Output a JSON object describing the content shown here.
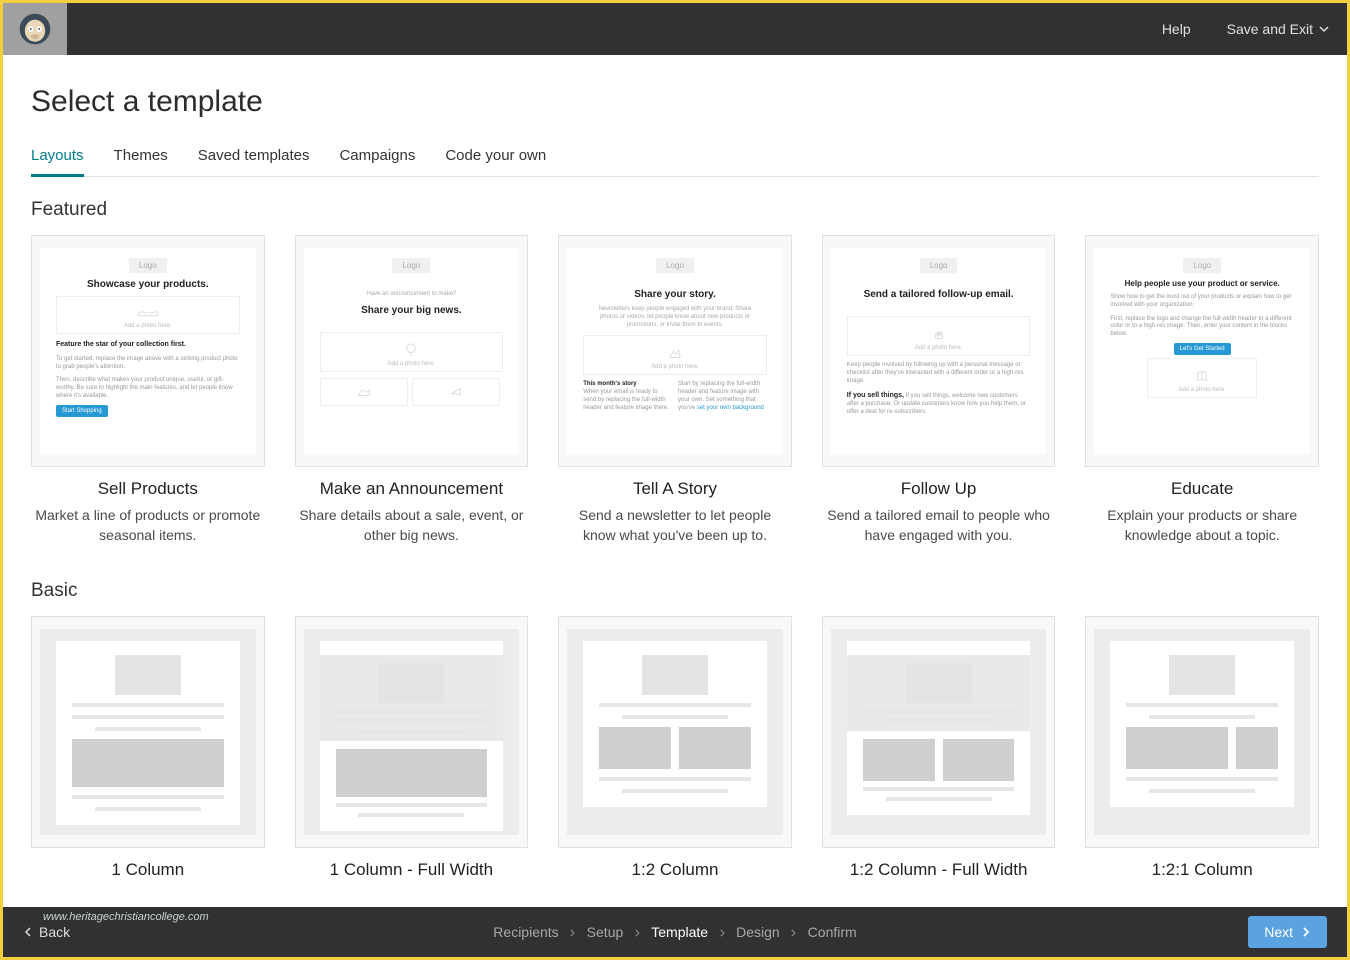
{
  "header": {
    "help": "Help",
    "save_exit": "Save and Exit"
  },
  "page": {
    "title": "Select a template"
  },
  "tabs": [
    {
      "label": "Layouts",
      "active": true
    },
    {
      "label": "Themes",
      "active": false
    },
    {
      "label": "Saved templates",
      "active": false
    },
    {
      "label": "Campaigns",
      "active": false
    },
    {
      "label": "Code your own",
      "active": false
    }
  ],
  "sections": {
    "featured": {
      "heading": "Featured",
      "cards": [
        {
          "title": "Sell Products",
          "desc": "Market a line of products or promote seasonal items.",
          "preview": {
            "logo": "Logo",
            "headline": "Showcase your products.",
            "photo": "Add a photo here.",
            "sub1": "Feature the star of your collection first.",
            "sub2": "To get started, replace the image above with a striking product photo to grab people's attention.",
            "sub3": "Then, describe what makes your product unique, useful, or gift-worthy. Be sure to highlight the main features, and let people know where it's available.",
            "btn": "Start Shopping"
          }
        },
        {
          "title": "Make an Announcement",
          "desc": "Share details about a sale, event, or other big news.",
          "preview": {
            "logo": "Logo",
            "eyebrow": "Have an announcement to make?",
            "headline": "Share your big news.",
            "photo": "Add a photo here."
          }
        },
        {
          "title": "Tell A Story",
          "desc": "Send a newsletter to let people know what you've been up to.",
          "preview": {
            "logo": "Logo",
            "headline": "Share your story.",
            "sub": "Newsletters keep people engaged with your brand. Share photos or videos, let people know about new products or promotions, or invite them to events.",
            "photo": "Add a photo here.",
            "col_head": "This month's story",
            "col1": "When your email is ready to send by replacing the full-width header and feature image there.",
            "col2": "Start by replacing the full-width header and feature image with your own. Set something that you've",
            "link": "set your own background"
          }
        },
        {
          "title": "Follow Up",
          "desc": "Send a tailored email to people who have engaged with you.",
          "preview": {
            "logo": "Logo",
            "headline": "Send a tailored follow-up email.",
            "photo": "Add a photo here.",
            "p1": "Keep people involved by following up with a personal message or checklist after they've interacted with a different order or a high-res image.",
            "p2": "If you sell things, welcome new customers after a purchase. Or update customers know how you help them, or offer a deal for re-subscribers."
          }
        },
        {
          "title": "Educate",
          "desc": "Explain your products or share knowledge about a topic.",
          "preview": {
            "logo": "Logo",
            "headline": "Help people use your product or service.",
            "p1": "Show how to get the most out of your products or explain how to get involved with your organization.",
            "p2": "First, replace the logo and change the full-width header to a different color or to a high-res image. Then, enter your content in the blocks below.",
            "btn": "Let's Get Started",
            "photo": "Add a photo here."
          }
        }
      ]
    },
    "basic": {
      "heading": "Basic",
      "cards": [
        {
          "title": "1 Column"
        },
        {
          "title": "1 Column - Full Width"
        },
        {
          "title": "1:2 Column"
        },
        {
          "title": "1:2 Column - Full Width"
        },
        {
          "title": "1:2:1 Column"
        }
      ]
    }
  },
  "footer": {
    "url": "www.heritagechristiancollege.com",
    "back": "Back",
    "steps": [
      "Recipients",
      "Setup",
      "Template",
      "Design",
      "Confirm"
    ],
    "active_step": "Template",
    "next": "Next"
  }
}
